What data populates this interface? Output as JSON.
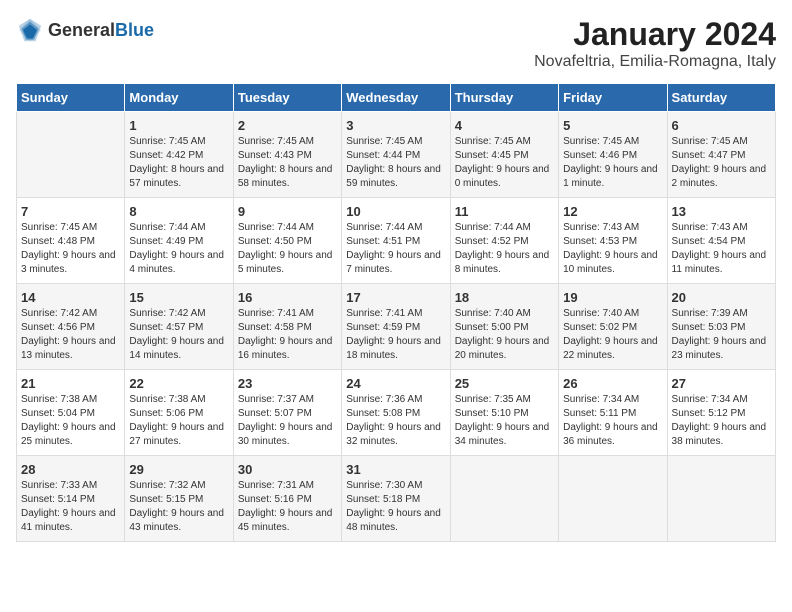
{
  "header": {
    "logo_general": "General",
    "logo_blue": "Blue",
    "title": "January 2024",
    "subtitle": "Novafeltria, Emilia-Romagna, Italy"
  },
  "days_of_week": [
    "Sunday",
    "Monday",
    "Tuesday",
    "Wednesday",
    "Thursday",
    "Friday",
    "Saturday"
  ],
  "weeks": [
    [
      {
        "day": "",
        "info": ""
      },
      {
        "day": "1",
        "info": "Sunrise: 7:45 AM\nSunset: 4:42 PM\nDaylight: 8 hours\nand 57 minutes."
      },
      {
        "day": "2",
        "info": "Sunrise: 7:45 AM\nSunset: 4:43 PM\nDaylight: 8 hours\nand 58 minutes."
      },
      {
        "day": "3",
        "info": "Sunrise: 7:45 AM\nSunset: 4:44 PM\nDaylight: 8 hours\nand 59 minutes."
      },
      {
        "day": "4",
        "info": "Sunrise: 7:45 AM\nSunset: 4:45 PM\nDaylight: 9 hours\nand 0 minutes."
      },
      {
        "day": "5",
        "info": "Sunrise: 7:45 AM\nSunset: 4:46 PM\nDaylight: 9 hours\nand 1 minute."
      },
      {
        "day": "6",
        "info": "Sunrise: 7:45 AM\nSunset: 4:47 PM\nDaylight: 9 hours\nand 2 minutes."
      }
    ],
    [
      {
        "day": "7",
        "info": "Sunrise: 7:45 AM\nSunset: 4:48 PM\nDaylight: 9 hours\nand 3 minutes."
      },
      {
        "day": "8",
        "info": "Sunrise: 7:44 AM\nSunset: 4:49 PM\nDaylight: 9 hours\nand 4 minutes."
      },
      {
        "day": "9",
        "info": "Sunrise: 7:44 AM\nSunset: 4:50 PM\nDaylight: 9 hours\nand 5 minutes."
      },
      {
        "day": "10",
        "info": "Sunrise: 7:44 AM\nSunset: 4:51 PM\nDaylight: 9 hours\nand 7 minutes."
      },
      {
        "day": "11",
        "info": "Sunrise: 7:44 AM\nSunset: 4:52 PM\nDaylight: 9 hours\nand 8 minutes."
      },
      {
        "day": "12",
        "info": "Sunrise: 7:43 AM\nSunset: 4:53 PM\nDaylight: 9 hours\nand 10 minutes."
      },
      {
        "day": "13",
        "info": "Sunrise: 7:43 AM\nSunset: 4:54 PM\nDaylight: 9 hours\nand 11 minutes."
      }
    ],
    [
      {
        "day": "14",
        "info": "Sunrise: 7:42 AM\nSunset: 4:56 PM\nDaylight: 9 hours\nand 13 minutes."
      },
      {
        "day": "15",
        "info": "Sunrise: 7:42 AM\nSunset: 4:57 PM\nDaylight: 9 hours\nand 14 minutes."
      },
      {
        "day": "16",
        "info": "Sunrise: 7:41 AM\nSunset: 4:58 PM\nDaylight: 9 hours\nand 16 minutes."
      },
      {
        "day": "17",
        "info": "Sunrise: 7:41 AM\nSunset: 4:59 PM\nDaylight: 9 hours\nand 18 minutes."
      },
      {
        "day": "18",
        "info": "Sunrise: 7:40 AM\nSunset: 5:00 PM\nDaylight: 9 hours\nand 20 minutes."
      },
      {
        "day": "19",
        "info": "Sunrise: 7:40 AM\nSunset: 5:02 PM\nDaylight: 9 hours\nand 22 minutes."
      },
      {
        "day": "20",
        "info": "Sunrise: 7:39 AM\nSunset: 5:03 PM\nDaylight: 9 hours\nand 23 minutes."
      }
    ],
    [
      {
        "day": "21",
        "info": "Sunrise: 7:38 AM\nSunset: 5:04 PM\nDaylight: 9 hours\nand 25 minutes."
      },
      {
        "day": "22",
        "info": "Sunrise: 7:38 AM\nSunset: 5:06 PM\nDaylight: 9 hours\nand 27 minutes."
      },
      {
        "day": "23",
        "info": "Sunrise: 7:37 AM\nSunset: 5:07 PM\nDaylight: 9 hours\nand 30 minutes."
      },
      {
        "day": "24",
        "info": "Sunrise: 7:36 AM\nSunset: 5:08 PM\nDaylight: 9 hours\nand 32 minutes."
      },
      {
        "day": "25",
        "info": "Sunrise: 7:35 AM\nSunset: 5:10 PM\nDaylight: 9 hours\nand 34 minutes."
      },
      {
        "day": "26",
        "info": "Sunrise: 7:34 AM\nSunset: 5:11 PM\nDaylight: 9 hours\nand 36 minutes."
      },
      {
        "day": "27",
        "info": "Sunrise: 7:34 AM\nSunset: 5:12 PM\nDaylight: 9 hours\nand 38 minutes."
      }
    ],
    [
      {
        "day": "28",
        "info": "Sunrise: 7:33 AM\nSunset: 5:14 PM\nDaylight: 9 hours\nand 41 minutes."
      },
      {
        "day": "29",
        "info": "Sunrise: 7:32 AM\nSunset: 5:15 PM\nDaylight: 9 hours\nand 43 minutes."
      },
      {
        "day": "30",
        "info": "Sunrise: 7:31 AM\nSunset: 5:16 PM\nDaylight: 9 hours\nand 45 minutes."
      },
      {
        "day": "31",
        "info": "Sunrise: 7:30 AM\nSunset: 5:18 PM\nDaylight: 9 hours\nand 48 minutes."
      },
      {
        "day": "",
        "info": ""
      },
      {
        "day": "",
        "info": ""
      },
      {
        "day": "",
        "info": ""
      }
    ]
  ]
}
